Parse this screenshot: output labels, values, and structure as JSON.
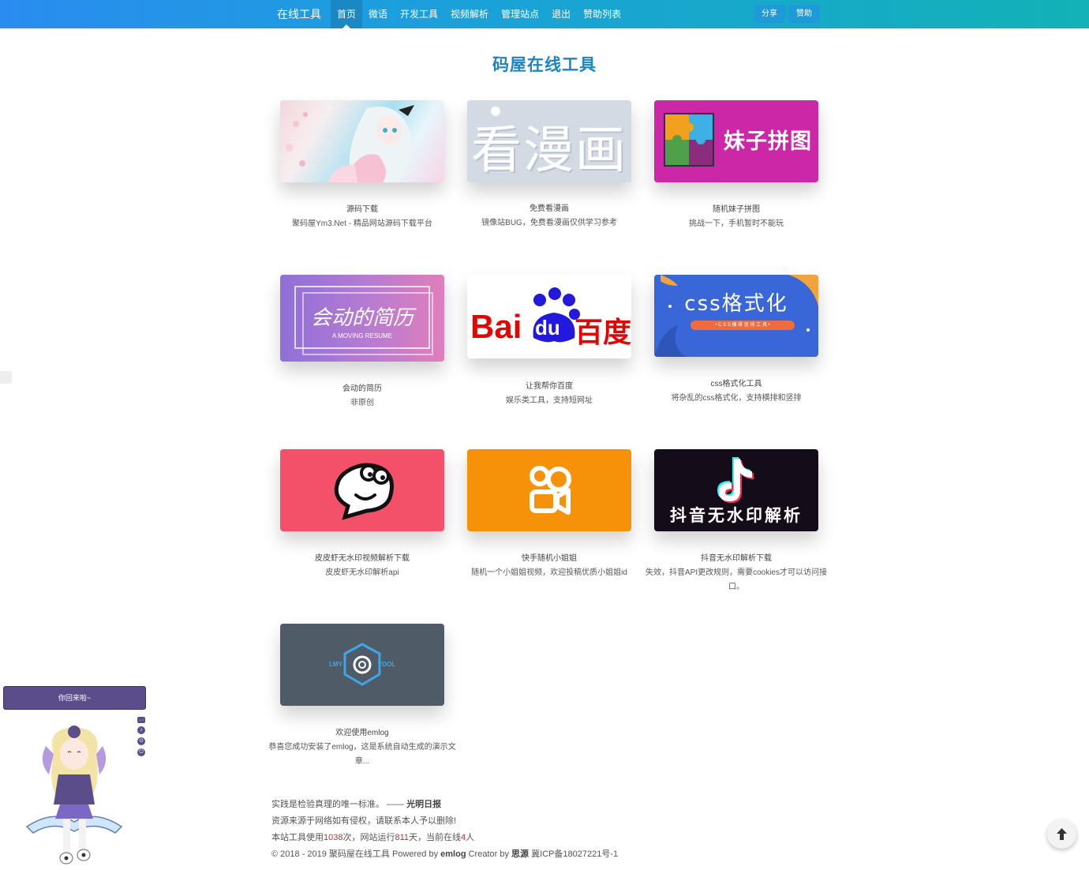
{
  "nav": {
    "brand": "在线工具",
    "items": [
      "首页",
      "微语",
      "开发工具",
      "视频解析",
      "管理站点",
      "退出",
      "赞助列表"
    ],
    "share_label": "分享",
    "donate_label": "赞助"
  },
  "page": {
    "title": "码屋在线工具"
  },
  "cards": [
    {
      "image_text": "",
      "title": "源码下载",
      "desc": "聚码屋Ym3.Net - 精品网站源码下载平台"
    },
    {
      "image_text": "看漫画",
      "title": "免费看漫画",
      "desc": "镜像站BUG，免费看漫画仅供学习参考"
    },
    {
      "image_text": "妹子拼图",
      "title": "随机妹子拼图",
      "desc": "挑战一下，手机暂时不能玩"
    },
    {
      "image_text": "会动的简历",
      "image_sub": "A MOVING RESUME",
      "title": "会动的简历",
      "desc": "非原创"
    },
    {
      "image_text_bai": "Bai",
      "image_text_du": "du",
      "image_text_cn": "百度",
      "title": "让我帮你百度",
      "desc": "娱乐类工具，支持短网址"
    },
    {
      "image_text": "css格式化",
      "image_sub": "• C S S 横 排 竖 排 工 具 •",
      "title": "css格式化工具",
      "desc": "将杂乱的css格式化，支持横排和竖排"
    },
    {
      "image_text": "",
      "title": "皮皮虾无水印视频解析下载",
      "desc": "皮皮虾无水印解析api"
    },
    {
      "image_text": "",
      "title": "快手随机小姐姐",
      "desc": "随机一个小姐姐视频，欢迎投稿优质小姐姐id"
    },
    {
      "image_text": "抖音无水印解析",
      "title": "抖音无水印解析下载",
      "desc": "失效，抖音API更改规则，需要cookies才可以访问接口。"
    },
    {
      "image_left": "LMY",
      "image_right": "TOOL",
      "title": "欢迎使用emlog",
      "desc": "恭喜您成功安装了emlog，这是系统自动生成的演示文章..."
    }
  ],
  "footer": {
    "quote": "实践是检验真理的唯一标准。 —— ",
    "quote_source": "光明日报",
    "notice": "资源来源于网络如有侵权，请联系本人予以删除!",
    "stats_a": "本站工具使用",
    "stats_uses": "1038",
    "stats_b": "次，网站运行",
    "stats_days": "811",
    "stats_c": "天，当前在线",
    "stats_online": "4",
    "stats_d": "人",
    "copyright": "© 2018 - 2019 聚码屋在线工具 Powered by ",
    "cms": "emlog",
    "creator": " Creator by ",
    "author": "思源",
    "icp": " 冀ICP备18027221号-1"
  },
  "widget": {
    "tip": "你回来啦~",
    "tools": [
      "···",
      "♪",
      "⊙",
      "⏻"
    ]
  },
  "colors": {
    "accent": "#1c84c6",
    "nav_start": "#2a8cf0",
    "nav_end": "#12b2b7",
    "stat": "#c22d2d"
  }
}
